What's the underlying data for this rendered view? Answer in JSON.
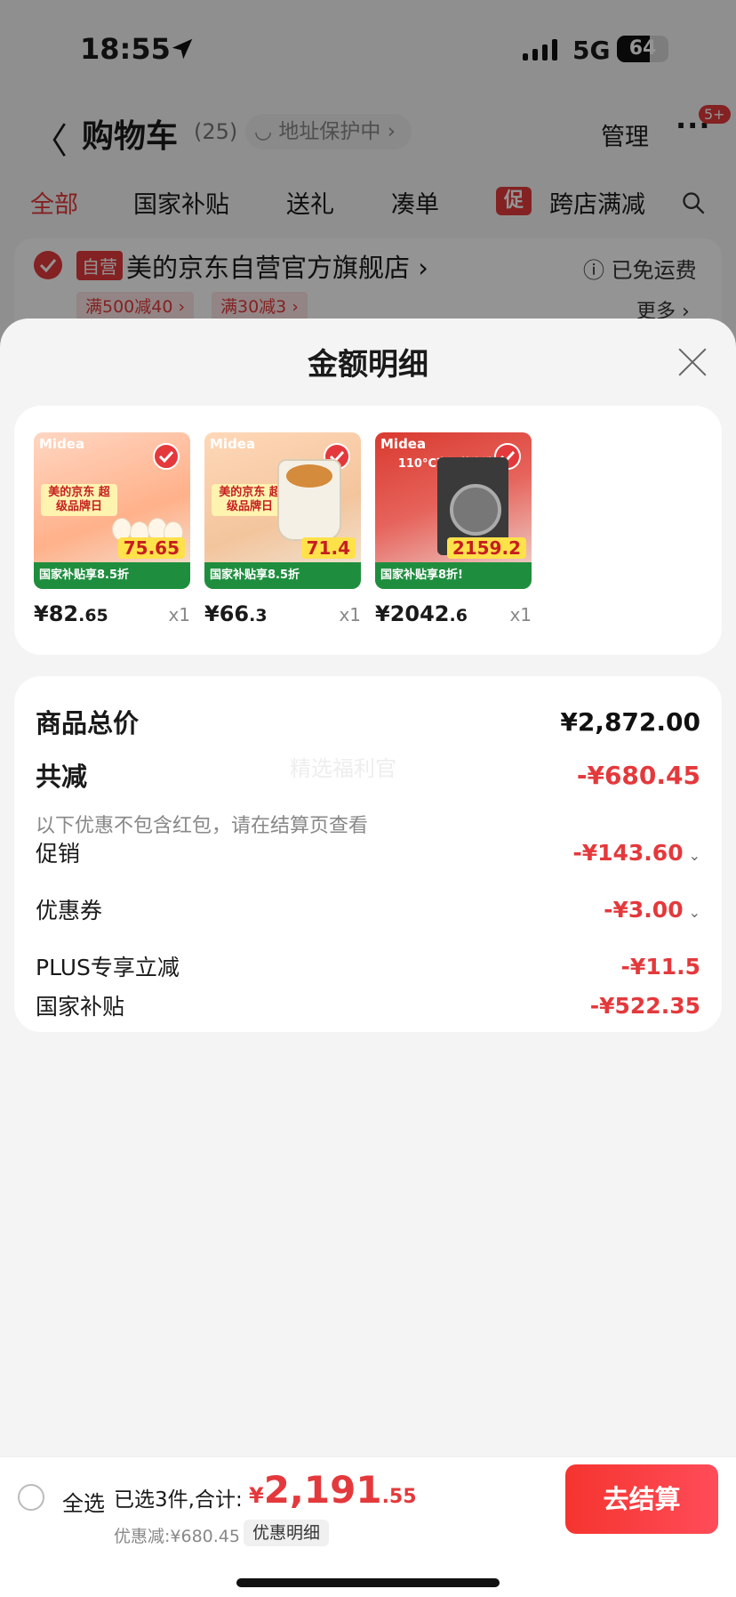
{
  "status_bar": {
    "time": "18:55",
    "network": "5G",
    "battery": "64",
    "battery_level": 0.64
  },
  "header": {
    "back": "〈",
    "title": "购物车",
    "count": "(25)",
    "address": "地址保护中 ›",
    "manage": "管理",
    "more": "···",
    "badge": "5+"
  },
  "tabs": [
    {
      "label": "全部",
      "active": true
    },
    {
      "label": "国家补贴"
    },
    {
      "label": "送礼"
    },
    {
      "label": "凑单"
    },
    {
      "label": "跨店满减",
      "tag": "促"
    }
  ],
  "store": {
    "self_tag": "自营",
    "name": "美的京东自营官方旗舰店 ›",
    "shipping": "ⓘ 已免运费",
    "promos": [
      "满500减40 ›",
      "满30减3 ›"
    ],
    "more": "更多 ›"
  },
  "sheet": {
    "title": "金额明细",
    "products": [
      {
        "brand": "Midea",
        "headline": "美的京东 超级品牌日",
        "banner": "国家补贴享8.5折",
        "banner_price": "75.65",
        "price_int": "¥82",
        "price_dec": ".65",
        "qty": "x1"
      },
      {
        "brand": "Midea",
        "headline": "美的京东 超级品牌日",
        "banner": "国家补贴享8.5折",
        "banner_price": "71.4",
        "price_int": "¥66",
        "price_dec": ".3",
        "qty": "x1"
      },
      {
        "brand": "Midea",
        "headline": "110°C高温蒸汽洗",
        "banner": "国家补贴享8折!",
        "banner_price": "2159.2",
        "price_int": "¥2042",
        "price_dec": ".6",
        "qty": "x1"
      }
    ],
    "summary": {
      "total_label": "商品总价",
      "total_value": "¥2,872.00",
      "reduce_label": "共减",
      "reduce_value": "-¥680.45",
      "note": "以下优惠不包含红包，请在结算页查看",
      "watermark": "精选福利官",
      "items": [
        {
          "label": "促销",
          "value": "-¥143.60",
          "caret": "⌄"
        },
        {
          "label": "优惠券",
          "value": "-¥3.00",
          "caret": "⌄"
        },
        {
          "label": "PLUS专享立减",
          "value": "-¥11.5"
        },
        {
          "label": "国家补贴",
          "value": "-¥522.35"
        }
      ]
    }
  },
  "bottom": {
    "select_all": "全选",
    "selected_text": "已选3件,合计:",
    "total_yen": "¥",
    "total_int": "2,191",
    "total_dec": ".55",
    "discount_text": "优惠减:¥680.45",
    "detail_button": "优惠明细",
    "checkout": "去结算"
  },
  "colors": {
    "accent": "#e4393c",
    "checkout_start": "#f5342f",
    "checkout_end": "#ff4c59"
  }
}
